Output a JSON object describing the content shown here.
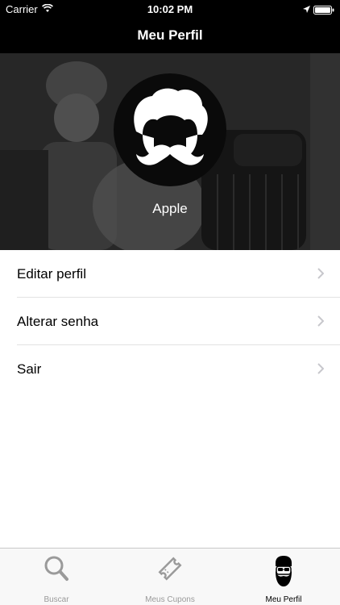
{
  "status_bar": {
    "carrier": "Carrier",
    "time": "10:02 PM"
  },
  "nav": {
    "title": "Meu Perfil"
  },
  "profile": {
    "name": "Apple"
  },
  "menu": {
    "items": [
      {
        "label": "Editar perfil"
      },
      {
        "label": "Alterar senha"
      },
      {
        "label": "Sair"
      }
    ]
  },
  "tabs": [
    {
      "label": "Buscar",
      "icon": "search-icon",
      "active": false
    },
    {
      "label": "Meus Cupons",
      "icon": "ticket-icon",
      "active": false
    },
    {
      "label": "Meu Perfil",
      "icon": "bearded-man-icon",
      "active": true
    }
  ],
  "colors": {
    "bar_background": "#000000",
    "tab_active": "#000000",
    "tab_inactive": "#9a9a9a"
  }
}
